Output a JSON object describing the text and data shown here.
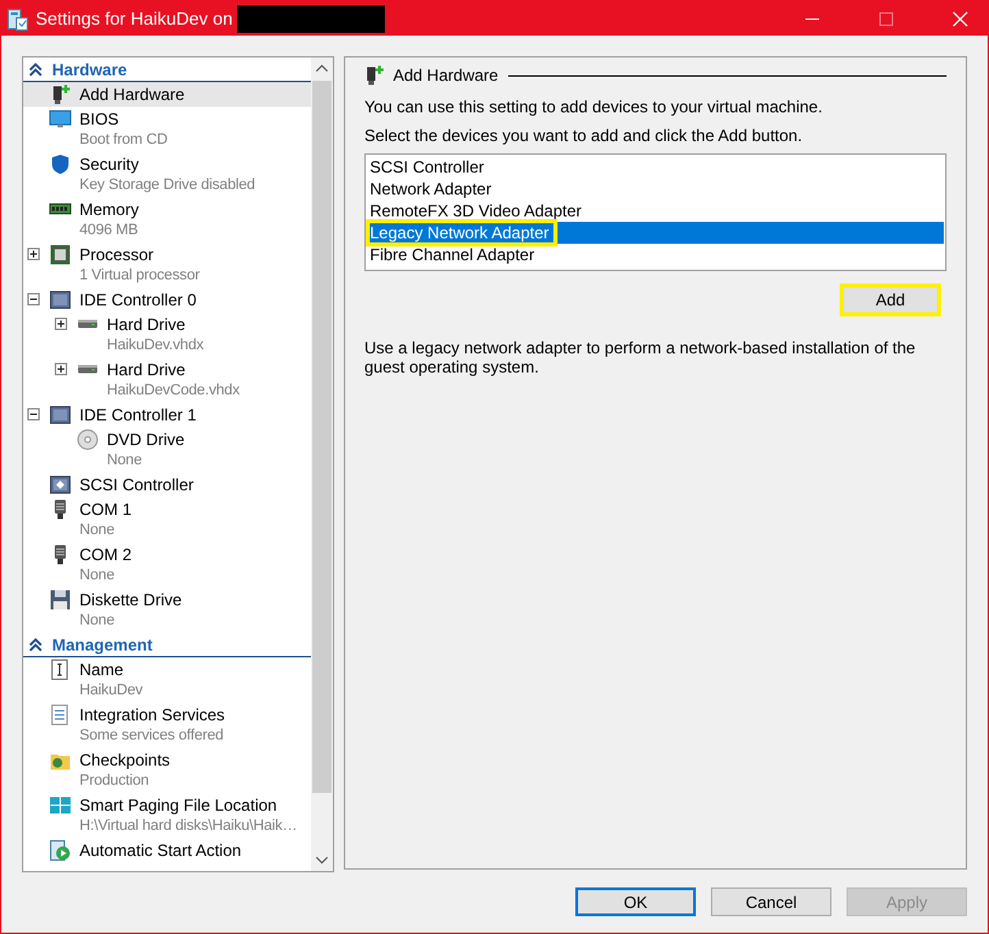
{
  "window": {
    "title": "Settings for HaikuDev on"
  },
  "sidebar": {
    "sections": [
      {
        "title": "Hardware",
        "expanded": true,
        "items": [
          {
            "label": "Add Hardware",
            "kind": "add-hardware",
            "selected": true
          },
          {
            "label": "BIOS",
            "detail": "Boot from CD",
            "kind": "bios",
            "selected": false
          },
          {
            "label": "Security",
            "detail": "Key Storage Drive disabled",
            "kind": "security",
            "selected": false
          },
          {
            "label": "Memory",
            "detail": "4096 MB",
            "kind": "memory",
            "selected": false
          },
          {
            "label": "Processor",
            "detail": "1 Virtual processor",
            "kind": "processor",
            "selected": false,
            "expanded": false
          },
          {
            "label": "IDE Controller 0",
            "kind": "ide",
            "selected": false,
            "expanded": true,
            "children": [
              {
                "label": "Hard Drive",
                "detail": "HaikuDev.vhdx",
                "kind": "hard-drive",
                "selected": false,
                "expanded": false
              },
              {
                "label": "Hard Drive",
                "detail": "HaikuDevCode.vhdx",
                "kind": "hard-drive",
                "selected": false,
                "expanded": false
              }
            ]
          },
          {
            "label": "IDE Controller 1",
            "kind": "ide",
            "selected": false,
            "expanded": true,
            "children": [
              {
                "label": "DVD Drive",
                "detail": "None",
                "kind": "dvd",
                "selected": false
              }
            ]
          },
          {
            "label": "SCSI Controller",
            "kind": "scsi",
            "selected": false
          },
          {
            "label": "COM 1",
            "detail": "None",
            "kind": "com",
            "selected": false
          },
          {
            "label": "COM 2",
            "detail": "None",
            "kind": "com",
            "selected": false
          },
          {
            "label": "Diskette Drive",
            "detail": "None",
            "kind": "diskette",
            "selected": false
          }
        ]
      },
      {
        "title": "Management",
        "expanded": true,
        "items": [
          {
            "label": "Name",
            "detail": "HaikuDev",
            "kind": "name",
            "selected": false
          },
          {
            "label": "Integration Services",
            "detail": "Some services offered",
            "kind": "integration",
            "selected": false
          },
          {
            "label": "Checkpoints",
            "detail": "Production",
            "kind": "checkpoints",
            "selected": false
          },
          {
            "label": "Smart Paging File Location",
            "detail": "H:\\Virtual hard disks\\Haiku\\Haik…",
            "kind": "paging",
            "selected": false
          },
          {
            "label": "Automatic Start Action",
            "kind": "start",
            "selected": false
          }
        ]
      }
    ]
  },
  "panel": {
    "title": "Add Hardware",
    "intro": "You can use this setting to add devices to your virtual machine.",
    "instruction": "Select the devices you want to add and click the Add button.",
    "devices": [
      {
        "label": "SCSI Controller",
        "selected": false,
        "highlighted": false
      },
      {
        "label": "Network Adapter",
        "selected": false,
        "highlighted": false
      },
      {
        "label": "RemoteFX 3D Video Adapter",
        "selected": false,
        "highlighted": false
      },
      {
        "label": "Legacy Network Adapter",
        "selected": true,
        "highlighted": true
      },
      {
        "label": "Fibre Channel Adapter",
        "selected": false,
        "highlighted": false
      }
    ],
    "add_button": {
      "label": "Add",
      "highlighted": true
    },
    "description": "Use a legacy network adapter to perform a network-based installation of the guest operating system."
  },
  "buttons": [
    {
      "label": "OK",
      "default": true,
      "disabled": false
    },
    {
      "label": "Cancel",
      "default": false,
      "disabled": false
    },
    {
      "label": "Apply",
      "default": false,
      "disabled": true
    }
  ]
}
